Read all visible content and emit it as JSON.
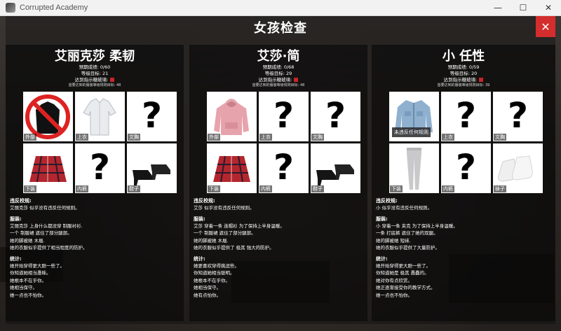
{
  "window": {
    "title": "Corrupted Academy",
    "minimize": "—",
    "maximize": "☐",
    "close": "✕"
  },
  "header": {
    "title": "女孩检查",
    "close_glyph": "✕"
  },
  "columns": [
    {
      "name": "艾丽克莎 柔韧",
      "stat1": "预期成绩: 0/60",
      "stat2": "等级目标: 21",
      "stat3": "达到指示糖玻璃:",
      "stat4": "首要达到的服装等级规则目标: 48",
      "tiles": [
        {
          "label": "外部",
          "kind": "forbidden-jacket"
        },
        {
          "label": "上衣",
          "kind": "shirt"
        },
        {
          "label": "文胸",
          "kind": "unknown"
        },
        {
          "label": "下装",
          "kind": "skirt"
        },
        {
          "label": "内裤",
          "kind": "unknown"
        },
        {
          "label": "鞋子",
          "kind": "heels"
        }
      ],
      "sec_violation": "违反校规:",
      "violation": "艾丽克莎 似乎没有违反任何规则。",
      "sec_clothing": "服装:",
      "clothing": [
        "艾丽克莎 上身什么都没穿 制服衬衫.",
        "一个 制服裙 遮住了部分腿部。",
        "她的脚被她 木屐.",
        "她的衣服似乎提供了相当程度的防护。"
      ],
      "sec_stats": "统计:",
      "stats": [
        "她开始穿得更大胆一些了。",
        "你知道她相当愚昧。",
        "她根本不在乎你。",
        "她相当保守。",
        "她一点也不怕你。"
      ]
    },
    {
      "name": "艾莎·简",
      "stat1": "预期成绩: 0/68",
      "stat2": "等级目标: 29",
      "stat3": "达到指示糖玻璃:",
      "stat4": "首要达到的服装等级规则目标: 48",
      "tiles": [
        {
          "label": "外部",
          "kind": "hoodie"
        },
        {
          "label": "上衣",
          "kind": "unknown"
        },
        {
          "label": "文胸",
          "kind": "unknown"
        },
        {
          "label": "下装",
          "kind": "skirt"
        },
        {
          "label": "内裤",
          "kind": "unknown"
        },
        {
          "label": "鞋子",
          "kind": "heels"
        }
      ],
      "sec_violation": "违反校规:",
      "violation": "艾莎 似乎没有违反任何规则。",
      "sec_clothing": "服装:",
      "clothing": [
        "艾莎 穿着一条 连帽衫 为了保持上半身温暖。",
        "一个 制服裙 遮住了部分腿部。",
        "她的脚被她 木屐.",
        "她的衣服似乎提供了 极其 强大的防护。"
      ],
      "sec_stats": "统计:",
      "stats": [
        "她更喜欢穿得挑逗些。",
        "你知道她相当聪明。",
        "她根本不在乎你。",
        "她相当保守。",
        "她有点怕你。"
      ]
    },
    {
      "name": "小 任性",
      "stat1": "预期成绩: 0/59",
      "stat2": "等级目标: 20",
      "stat3": "达到指示糖玻璃:",
      "stat4": "首要达到的服装等级规则目标: 39",
      "tiles": [
        {
          "label": "",
          "kind": "denim-jacket"
        },
        {
          "label": "上衣",
          "kind": "unknown"
        },
        {
          "label": "文胸",
          "kind": "unknown"
        },
        {
          "label": "下装",
          "kind": "leggings"
        },
        {
          "label": "内裤",
          "kind": "unknown"
        },
        {
          "label": "袜子",
          "kind": "socks"
        }
      ],
      "tooltip": "未违反任何规则",
      "sec_violation": "违反校规:",
      "violation": "小 似乎没有违反任何规则。",
      "sec_clothing": "服装:",
      "clothing": [
        "小 穿着一条 夹克 为了保持上半身温暖。",
        "一条 打底裤 遮住了她的双腿。",
        "她的脚被她 短袜.",
        "她的衣服似乎提供了大量防护。"
      ],
      "sec_stats": "统计:",
      "stats": [
        "她开始穿得更大胆一些了。",
        "你知道她是 极其 愚蠢的。",
        "她对你有点欣赏。",
        "她正逐渐接受你的教学方式。",
        "她一点也不怕你。"
      ]
    }
  ]
}
